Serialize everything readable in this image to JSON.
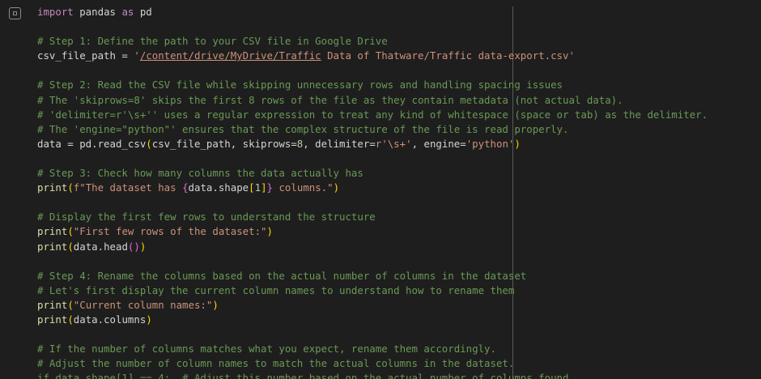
{
  "editor": {
    "lines": [
      {
        "segments": [
          {
            "t": "import",
            "c": "kw"
          },
          {
            "t": " pandas "
          },
          {
            "t": "as",
            "c": "kw"
          },
          {
            "t": " pd"
          }
        ]
      },
      {
        "segments": []
      },
      {
        "segments": [
          {
            "t": "# Step 1: Define the path to your CSV file in Google Drive",
            "c": "cm"
          }
        ]
      },
      {
        "segments": [
          {
            "t": "csv_file_path = "
          },
          {
            "t": "'",
            "c": "str"
          },
          {
            "t": "/content/drive/MyDrive/Traffic",
            "c": "str ul"
          },
          {
            "t": " Data of Thatware/Traffic data-export.csv'",
            "c": "str"
          }
        ]
      },
      {
        "segments": []
      },
      {
        "segments": [
          {
            "t": "# Step 2: Read the CSV file while skipping unnecessary rows and handling spacing issues",
            "c": "cm"
          }
        ]
      },
      {
        "segments": [
          {
            "t": "# The 'skiprows=8' skips the first 8 rows of the file as they contain metadata (not actual data).",
            "c": "cm"
          }
        ]
      },
      {
        "segments": [
          {
            "t": "# 'delimiter=r'\\s+'' uses a regular expression to treat any kind of whitespace (space or tab) as the delimiter.",
            "c": "cm"
          }
        ]
      },
      {
        "segments": [
          {
            "t": "# The 'engine=\"python\"' ensures that the complex structure of the file is read properly.",
            "c": "cm"
          }
        ]
      },
      {
        "segments": [
          {
            "t": "data = pd.read_csv"
          },
          {
            "t": "(",
            "c": "br"
          },
          {
            "t": "csv_file_path, skiprows="
          },
          {
            "t": "8",
            "c": "num"
          },
          {
            "t": ", delimiter="
          },
          {
            "t": "r'\\s+'",
            "c": "str"
          },
          {
            "t": ", engine="
          },
          {
            "t": "'python'",
            "c": "str"
          },
          {
            "t": ")",
            "c": "br"
          }
        ]
      },
      {
        "segments": []
      },
      {
        "segments": [
          {
            "t": "# Step 3: Check how many columns the data actually has",
            "c": "cm"
          }
        ]
      },
      {
        "segments": [
          {
            "t": "print",
            "c": "fn"
          },
          {
            "t": "(",
            "c": "br"
          },
          {
            "t": "f\"The dataset has ",
            "c": "str"
          },
          {
            "t": "{",
            "c": "br2"
          },
          {
            "t": "data.shape"
          },
          {
            "t": "[",
            "c": "br"
          },
          {
            "t": "1",
            "c": "num"
          },
          {
            "t": "]",
            "c": "br"
          },
          {
            "t": "}",
            "c": "br2"
          },
          {
            "t": " columns.\"",
            "c": "str"
          },
          {
            "t": ")",
            "c": "br"
          }
        ]
      },
      {
        "segments": []
      },
      {
        "segments": [
          {
            "t": "# Display the first few rows to understand the structure",
            "c": "cm"
          }
        ]
      },
      {
        "segments": [
          {
            "t": "print",
            "c": "fn"
          },
          {
            "t": "(",
            "c": "br"
          },
          {
            "t": "\"First few rows of the dataset:\"",
            "c": "str"
          },
          {
            "t": ")",
            "c": "br"
          }
        ]
      },
      {
        "segments": [
          {
            "t": "print",
            "c": "fn"
          },
          {
            "t": "(",
            "c": "br"
          },
          {
            "t": "data.head"
          },
          {
            "t": "()",
            "c": "br2"
          },
          {
            "t": ")",
            "c": "br"
          }
        ]
      },
      {
        "segments": []
      },
      {
        "segments": [
          {
            "t": "# Step 4: Rename the columns based on the actual number of columns in the dataset",
            "c": "cm"
          }
        ]
      },
      {
        "segments": [
          {
            "t": "# Let's first display the current column names to understand how to rename them",
            "c": "cm"
          }
        ]
      },
      {
        "segments": [
          {
            "t": "print",
            "c": "fn"
          },
          {
            "t": "(",
            "c": "br"
          },
          {
            "t": "\"Current column names:\"",
            "c": "str"
          },
          {
            "t": ")",
            "c": "br"
          }
        ]
      },
      {
        "segments": [
          {
            "t": "print",
            "c": "fn"
          },
          {
            "t": "(",
            "c": "br"
          },
          {
            "t": "data.columns"
          },
          {
            "t": ")",
            "c": "br"
          }
        ]
      },
      {
        "segments": []
      },
      {
        "segments": [
          {
            "t": "# If the number of columns matches what you expect, rename them accordingly.",
            "c": "cm"
          }
        ]
      },
      {
        "segments": [
          {
            "t": "# Adjust the number of column names to match the actual columns in the dataset.",
            "c": "cm"
          }
        ]
      },
      {
        "segments": [
          {
            "t": "if data.shape[1] == 4:  # Adjust this number based on the actual number of columns found",
            "c": "cm"
          }
        ]
      }
    ]
  }
}
